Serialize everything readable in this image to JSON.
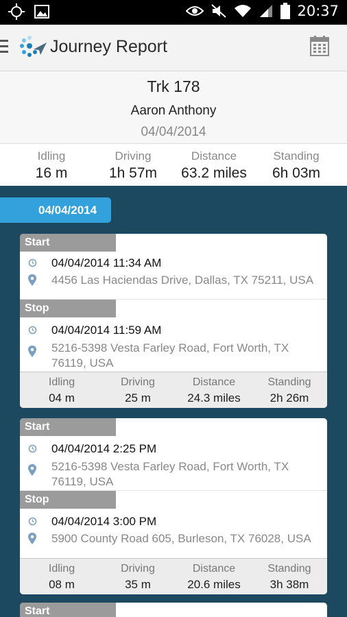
{
  "status_bar": {
    "time": "20:37",
    "icons": [
      "gps-icon",
      "image-icon",
      "eye-icon",
      "mute-icon",
      "wifi-icon",
      "signal-icon",
      "battery-icon"
    ]
  },
  "app_bar": {
    "title": "Journey Report"
  },
  "journey": {
    "vehicle": "Trk 178",
    "driver": "Aaron Anthony",
    "date": "04/04/2014",
    "summary": [
      {
        "label": "Idling",
        "value": "16 m"
      },
      {
        "label": "Driving",
        "value": "1h 57m"
      },
      {
        "label": "Distance",
        "value": "63.2 miles"
      },
      {
        "label": "Standing",
        "value": "6h 03m"
      }
    ]
  },
  "date_tab": "04/04/2014",
  "labels": {
    "start": "Start",
    "stop": "Stop"
  },
  "trips": [
    {
      "start_time": "04/04/2014 11:34 AM",
      "start_address": "4456 Las Haciendas Drive, Dallas, TX 75211, USA",
      "stop_time": "04/04/2014 11:59 AM",
      "stop_address": "5216-5398 Vesta Farley Road, Fort Worth, TX 76119, USA",
      "stats": [
        {
          "label": "Idling",
          "value": "04 m"
        },
        {
          "label": "Driving",
          "value": "25 m"
        },
        {
          "label": "Distance",
          "value": "24.3 miles"
        },
        {
          "label": "Standing",
          "value": "2h 26m"
        }
      ]
    },
    {
      "start_time": "04/04/2014 2:25 PM",
      "start_address": "5216-5398 Vesta Farley Road, Fort Worth, TX 76119, USA",
      "stop_time": "04/04/2014 3:00 PM",
      "stop_address": "5900 County Road 605, Burleson, TX 76028, USA",
      "stats": [
        {
          "label": "Idling",
          "value": "08 m"
        },
        {
          "label": "Driving",
          "value": "35 m"
        },
        {
          "label": "Distance",
          "value": "20.6 miles"
        },
        {
          "label": "Standing",
          "value": "3h 38m"
        }
      ]
    }
  ],
  "colors": {
    "background": "#1d4960",
    "accent": "#33a1dc",
    "segment_label": "#9b9b9b"
  }
}
